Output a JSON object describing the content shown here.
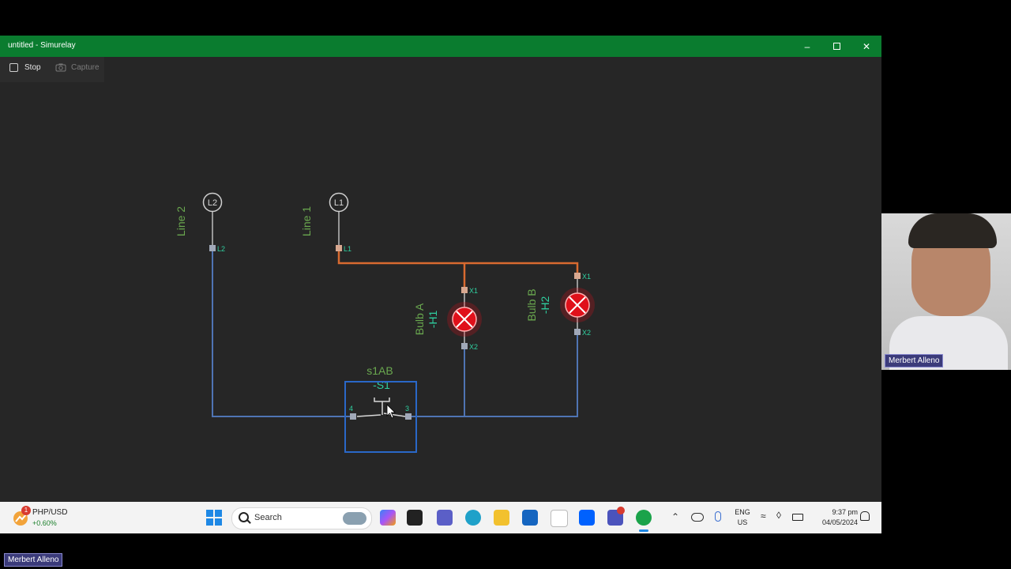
{
  "window": {
    "title": "untitled - Simurelay",
    "minimize_icon": "minimize-icon",
    "maximize_icon": "restore-icon",
    "close_icon": "close-icon"
  },
  "toolbar": {
    "stop_label": "Stop",
    "capture_label": "Capture"
  },
  "circuit": {
    "line2_label": "Line 2",
    "line1_label": "Line 1",
    "supply_l2": "L2",
    "supply_l1": "L1",
    "term_l2": "L2",
    "term_l1": "L1",
    "bulb_a": {
      "name": "Bulb A",
      "tag": "-H1",
      "x1": "X1",
      "x2": "X2"
    },
    "bulb_b": {
      "name": "Bulb B",
      "tag": "-H2",
      "x1": "X1",
      "x2": "X2"
    },
    "switch": {
      "name": "s1AB",
      "tag": "-S1",
      "term_left": "4",
      "term_right": "3"
    },
    "colors": {
      "live": "#d86a30",
      "neutral": "#4f74b3",
      "label": "#6aa84f",
      "tag": "#2fd0a0",
      "bulb": "#e0101a",
      "switch_frame": "#2a68c8"
    }
  },
  "taskbar": {
    "widget": {
      "badge": "1",
      "title": "PHP/USD",
      "change": "+0.60%"
    },
    "search_placeholder": "Search",
    "lang_line1": "ENG",
    "lang_line2": "US",
    "time": "9:37 pm",
    "date": "04/05/2024"
  },
  "participant": {
    "name_cam": "Merbert Alleno",
    "name_bottom": "Merbert Alleno"
  }
}
